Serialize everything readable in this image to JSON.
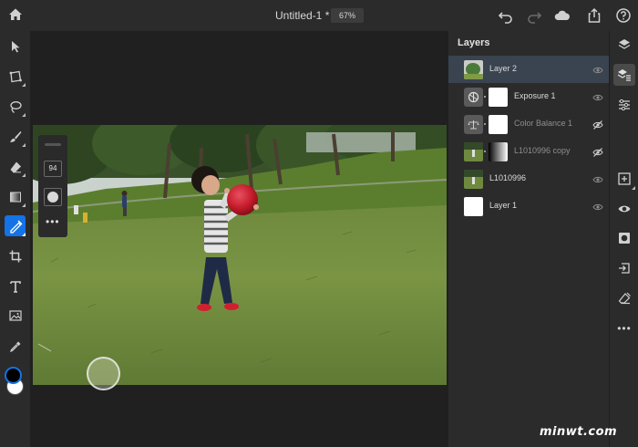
{
  "topbar": {
    "title": "Untitled-1 *",
    "zoom": "67%",
    "icons": [
      "home-icon",
      "undo-icon",
      "redo-icon",
      "cloud-icon",
      "share-icon",
      "help-icon"
    ]
  },
  "tools": {
    "items": [
      "select-arrow-icon",
      "transform-icon",
      "lasso-icon",
      "brush-icon",
      "eraser-icon",
      "gradient-icon",
      "healing-brush-icon",
      "crop-icon",
      "type-icon",
      "place-image-icon",
      "eyedropper-icon"
    ],
    "active": "healing-brush-icon",
    "foreground_color": "#000000",
    "background_color": "#ffffff",
    "accent": "#1473e6"
  },
  "brush_panel": {
    "size": "94",
    "more": "•••"
  },
  "layers": {
    "title": "Layers",
    "items": [
      {
        "name": "Layer 2",
        "selected": true,
        "visible": true,
        "kind": "pixel"
      },
      {
        "name": "Exposure 1",
        "selected": false,
        "visible": true,
        "kind": "adjustment-exposure"
      },
      {
        "name": "Color Balance 1",
        "selected": false,
        "visible": false,
        "kind": "adjustment-color-balance"
      },
      {
        "name": "L1010996 copy",
        "selected": false,
        "visible": false,
        "kind": "pixel-with-mask"
      },
      {
        "name": "L1010996",
        "selected": false,
        "visible": true,
        "kind": "pixel"
      },
      {
        "name": "Layer 1",
        "selected": false,
        "visible": true,
        "kind": "blank"
      }
    ]
  },
  "right_tools": {
    "items": [
      "layers-stack-icon",
      "layer-properties-icon",
      "adjustments-icon",
      "add-layer-icon",
      "visibility-icon",
      "mask-icon",
      "import-icon",
      "clear-icon",
      "more-icon"
    ],
    "more_label": "•••"
  },
  "watermark": "minwt.com"
}
